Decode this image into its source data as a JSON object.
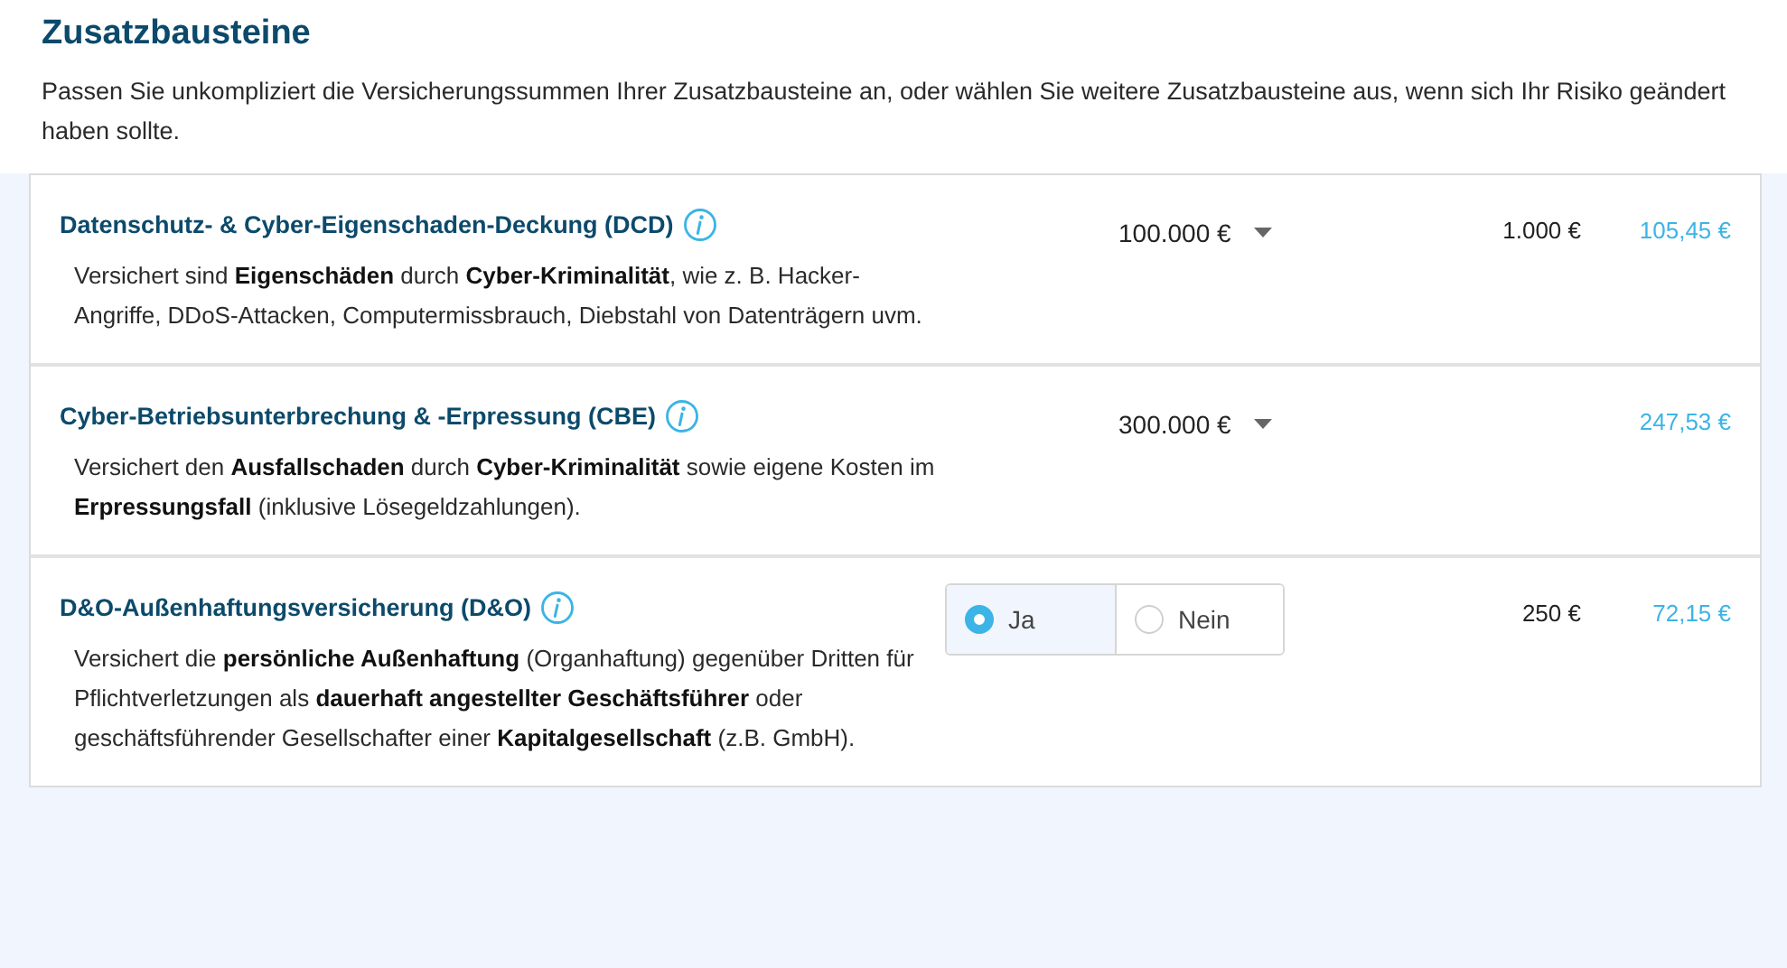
{
  "heading": "Zusatzbausteine",
  "intro": "Passen Sie unkompliziert die Versicherungssummen Ihrer Zusatzbausteine an, oder wählen Sie weitere Zusatzbausteine aus, wenn sich Ihr Risiko geändert haben sollte.",
  "modules": [
    {
      "title": "Datenschutz- & Cyber-Eigenschaden-Deckung (DCD)",
      "description": [
        "Versichert sind **Eigenschäden** durch **Cyber-Kriminalität**, wie z. B. Hacker-Angriffe, DDoS-Attacken, Computermissbrauch, Diebstahl von Datenträgern uvm."
      ],
      "kind": "dropdown",
      "sum": "100.000 €",
      "deductible": "1.000 €",
      "price": "105,45 €"
    },
    {
      "title": "Cyber-Betriebsunterbrechung & -Erpressung (CBE)",
      "description": [
        "Versichert den **Ausfallschaden** durch **Cyber-Kriminalität** sowie eigene Kosten im",
        "**Erpressungsfall** (inklusive Lösegeldzahlungen)."
      ],
      "kind": "dropdown",
      "sum": "300.000 €",
      "price": "247,53 €"
    },
    {
      "title": "D&O-Außenhaftungsversicherung (D&O)",
      "description": [
        "Versichert die **persönliche Außenhaftung** (Organhaftung) gegenüber Dritten für Pflichtverletzungen als **dauerhaft angestellter Geschäftsführer** oder geschäftsführender Gesellschafter einer **Kapitalgesellschaft** (z.B. GmbH)."
      ],
      "kind": "radio",
      "options": [
        {
          "label": "Ja",
          "selected": true
        },
        {
          "label": "Nein",
          "selected": false
        }
      ],
      "deductible": "250 €",
      "price": "72,15 €"
    }
  ]
}
